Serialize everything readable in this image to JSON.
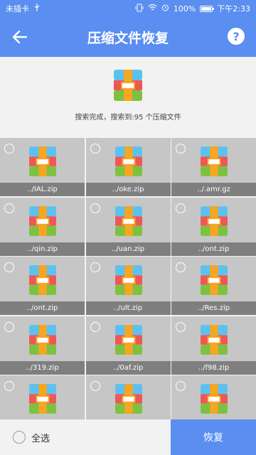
{
  "status_bar": {
    "carrier": "未插卡",
    "usb_icon": "usb-icon",
    "battery_percent": "100%",
    "time": "下午2:33"
  },
  "app_bar": {
    "title": "压缩文件恢复",
    "back_icon": "arrow-left-icon",
    "help_icon": "question-icon",
    "help_glyph": "?"
  },
  "summary": {
    "text": "搜索完成，搜索到:95 个压缩文件"
  },
  "files": [
    {
      "name": "../IAL.zip"
    },
    {
      "name": "../oke.zip"
    },
    {
      "name": "../.amr.gz"
    },
    {
      "name": "../qin.zip"
    },
    {
      "name": "../uan.zip"
    },
    {
      "name": "../ont.zip"
    },
    {
      "name": "../ont.zip"
    },
    {
      "name": "../ult.zip"
    },
    {
      "name": "../Res.zip"
    },
    {
      "name": "../319.zip"
    },
    {
      "name": "../0af.zip"
    },
    {
      "name": "../f98.zip"
    },
    {
      "name": ""
    },
    {
      "name": ""
    },
    {
      "name": ""
    }
  ],
  "bottom": {
    "select_all": "全选",
    "recover": "恢复"
  },
  "colors": {
    "primary": "#5a8ef0",
    "zip_blue": "#5bc2f0",
    "zip_red": "#ef5757",
    "zip_green": "#7cc240",
    "zip_strap": "#f5a623"
  }
}
